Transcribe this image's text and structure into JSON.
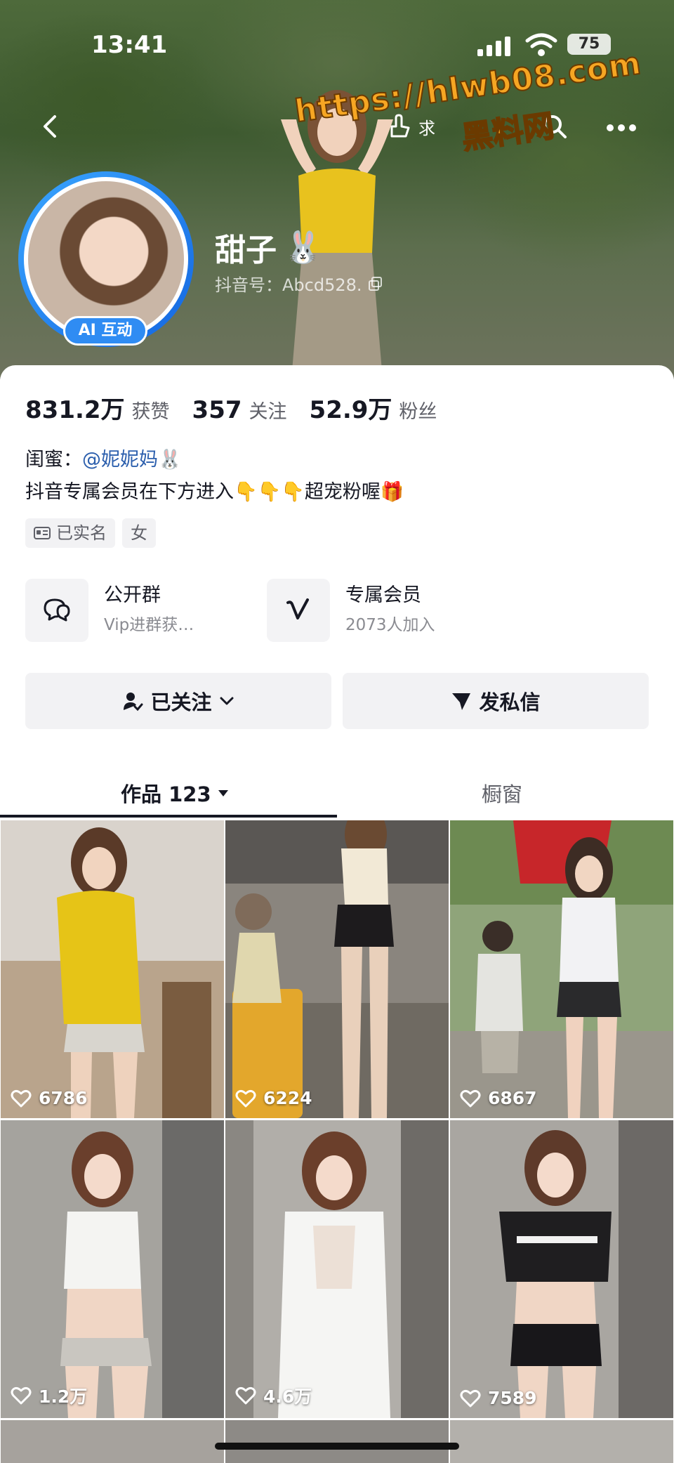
{
  "status_bar": {
    "time": "13:41",
    "battery": "75"
  },
  "top_nav": {
    "action_label": "求",
    "back_icon": "chevron-left-icon",
    "search_icon": "search-icon",
    "more_icon": "more-icon"
  },
  "watermark": {
    "url": "https://hlwb08.com",
    "site_name": "黑料网"
  },
  "profile": {
    "name": "甜子",
    "name_emoji": "🐰",
    "douyin_id": "抖音号：Abcd528.",
    "ai_badge": "AI 互动"
  },
  "stats": [
    {
      "value": "831.2万",
      "label": "获赞"
    },
    {
      "value": "357",
      "label": "关注"
    },
    {
      "value": "52.9万",
      "label": "粉丝"
    }
  ],
  "bio": {
    "line1_prefix": "闺蜜：",
    "line1_mention": "@妮妮妈",
    "line1_emoji": "🐰",
    "line2": "抖音专属会员在下方进入👇👇👇超宠粉喔🎁"
  },
  "tags": [
    {
      "label": "已实名",
      "icon": "id-card-icon"
    },
    {
      "label": "女",
      "icon": ""
    }
  ],
  "features": [
    {
      "title": "公开群",
      "subtitle": "Vip进群获…",
      "icon": "group-chat-icon"
    },
    {
      "title": "专属会员",
      "subtitle": "2073人加入",
      "icon": "member-v-icon"
    }
  ],
  "actions": {
    "follow_label": "已关注",
    "message_label": "发私信"
  },
  "tabs": [
    {
      "label": "作品 123",
      "active": true
    },
    {
      "label": "橱窗",
      "active": false
    }
  ],
  "videos": [
    {
      "likes": "6786"
    },
    {
      "likes": "6224"
    },
    {
      "likes": "6867"
    },
    {
      "likes": "1.2万"
    },
    {
      "likes": "4.6万"
    },
    {
      "likes": "7589"
    }
  ],
  "colors": {
    "accent_blue": "#2f8cf3",
    "mention": "#2c5fad",
    "text": "#161823",
    "muted": "#5f6068"
  }
}
